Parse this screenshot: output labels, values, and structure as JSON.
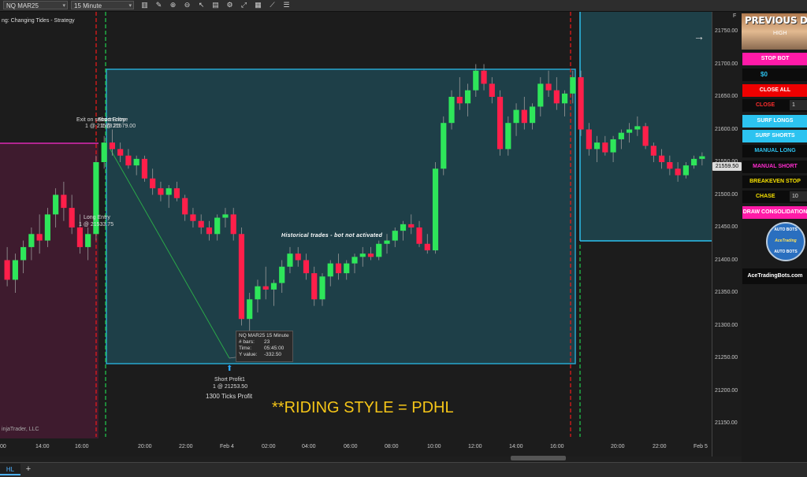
{
  "toolbar": {
    "instrument": "NQ MAR25",
    "interval": "15 Minute"
  },
  "chart": {
    "strategy_label": "ng: Changing Tides - Strategy",
    "copyright": "injaTrader, LLC",
    "annotation_main": "**RIDING STYLE = PDHL",
    "historical_note": "Historical trades - bot not activated",
    "exit_label_1": "Exit on session close",
    "exit_label_2": "Short Entry",
    "exit_label_1b": "1 @ 21573.25",
    "exit_label_2b": "1 @ 21579.00",
    "long_entry_label": "Long Entry",
    "long_entry_price": "1 @ 21533.75",
    "short_profit_label": "Short Profit1",
    "short_profit_price": "1 @ 21253.50",
    "ticks_profit": "1300 Ticks Profit",
    "current_price": "21559.50",
    "panel_letter": "F"
  },
  "tooltip": {
    "title": "NQ MAR25 15 Minute",
    "bars_label": "# bars:",
    "bars_value": "23",
    "time_label": "Time:",
    "time_value": "05:45:00",
    "yvalue_label": "Y value:",
    "yvalue_value": "-332.50"
  },
  "y_ticks": [
    "21750.00",
    "21700.00",
    "21650.00",
    "21600.00",
    "21550.00",
    "21500.00",
    "21450.00",
    "21400.00",
    "21350.00",
    "21300.00",
    "21250.00",
    "21200.00",
    "21150.00"
  ],
  "x_ticks": [
    "00",
    "14:00",
    "16:00",
    "20:00",
    "22:00",
    "Feb 4",
    "02:00",
    "04:00",
    "06:00",
    "08:00",
    "10:00",
    "12:00",
    "14:00",
    "16:00",
    "20:00",
    "22:00",
    "Feb 5"
  ],
  "candles": [
    {
      "o": 21400,
      "h": 21420,
      "l": 21360,
      "c": 21370
    },
    {
      "o": 21370,
      "h": 21410,
      "l": 21350,
      "c": 21400
    },
    {
      "o": 21400,
      "h": 21430,
      "l": 21380,
      "c": 21420
    },
    {
      "o": 21420,
      "h": 21450,
      "l": 21400,
      "c": 21440
    },
    {
      "o": 21440,
      "h": 21470,
      "l": 21410,
      "c": 21430
    },
    {
      "o": 21430,
      "h": 21480,
      "l": 21420,
      "c": 21470
    },
    {
      "o": 21470,
      "h": 21510,
      "l": 21450,
      "c": 21500
    },
    {
      "o": 21500,
      "h": 21520,
      "l": 21460,
      "c": 21480
    },
    {
      "o": 21480,
      "h": 21500,
      "l": 21440,
      "c": 21450
    },
    {
      "o": 21450,
      "h": 21470,
      "l": 21410,
      "c": 21420
    },
    {
      "o": 21420,
      "h": 21450,
      "l": 21400,
      "c": 21440
    },
    {
      "o": 21440,
      "h": 21560,
      "l": 21430,
      "c": 21550
    },
    {
      "o": 21550,
      "h": 21590,
      "l": 21540,
      "c": 21580
    },
    {
      "o": 21580,
      "h": 21600,
      "l": 21560,
      "c": 21570
    },
    {
      "o": 21570,
      "h": 21580,
      "l": 21550,
      "c": 21560
    },
    {
      "o": 21560,
      "h": 21570,
      "l": 21540,
      "c": 21545
    },
    {
      "o": 21545,
      "h": 21560,
      "l": 21530,
      "c": 21555
    },
    {
      "o": 21555,
      "h": 21560,
      "l": 21520,
      "c": 21525
    },
    {
      "o": 21525,
      "h": 21540,
      "l": 21500,
      "c": 21510
    },
    {
      "o": 21510,
      "h": 21520,
      "l": 21490,
      "c": 21500
    },
    {
      "o": 21500,
      "h": 21515,
      "l": 21480,
      "c": 21510
    },
    {
      "o": 21510,
      "h": 21520,
      "l": 21490,
      "c": 21495
    },
    {
      "o": 21495,
      "h": 21500,
      "l": 21460,
      "c": 21470
    },
    {
      "o": 21470,
      "h": 21480,
      "l": 21450,
      "c": 21460
    },
    {
      "o": 21460,
      "h": 21470,
      "l": 21440,
      "c": 21450
    },
    {
      "o": 21450,
      "h": 21460,
      "l": 21430,
      "c": 21440
    },
    {
      "o": 21440,
      "h": 21470,
      "l": 21430,
      "c": 21465
    },
    {
      "o": 21465,
      "h": 21480,
      "l": 21450,
      "c": 21470
    },
    {
      "o": 21470,
      "h": 21480,
      "l": 21430,
      "c": 21440
    },
    {
      "o": 21440,
      "h": 21450,
      "l": 21300,
      "c": 21310
    },
    {
      "o": 21310,
      "h": 21350,
      "l": 21260,
      "c": 21340
    },
    {
      "o": 21340,
      "h": 21370,
      "l": 21320,
      "c": 21360
    },
    {
      "o": 21360,
      "h": 21390,
      "l": 21340,
      "c": 21355
    },
    {
      "o": 21355,
      "h": 21370,
      "l": 21330,
      "c": 21365
    },
    {
      "o": 21365,
      "h": 21400,
      "l": 21350,
      "c": 21390
    },
    {
      "o": 21390,
      "h": 21420,
      "l": 21380,
      "c": 21410
    },
    {
      "o": 21410,
      "h": 21420,
      "l": 21390,
      "c": 21400
    },
    {
      "o": 21400,
      "h": 21410,
      "l": 21370,
      "c": 21380
    },
    {
      "o": 21380,
      "h": 21390,
      "l": 21330,
      "c": 21340
    },
    {
      "o": 21340,
      "h": 21380,
      "l": 21330,
      "c": 21375
    },
    {
      "o": 21375,
      "h": 21400,
      "l": 21360,
      "c": 21395
    },
    {
      "o": 21395,
      "h": 21410,
      "l": 21370,
      "c": 21380
    },
    {
      "o": 21380,
      "h": 21400,
      "l": 21370,
      "c": 21395
    },
    {
      "o": 21395,
      "h": 21410,
      "l": 21380,
      "c": 21405
    },
    {
      "o": 21405,
      "h": 21420,
      "l": 21390,
      "c": 21410
    },
    {
      "o": 21410,
      "h": 21420,
      "l": 21400,
      "c": 21405
    },
    {
      "o": 21405,
      "h": 21430,
      "l": 21400,
      "c": 21425
    },
    {
      "o": 21425,
      "h": 21440,
      "l": 21410,
      "c": 21430
    },
    {
      "o": 21430,
      "h": 21450,
      "l": 21420,
      "c": 21445
    },
    {
      "o": 21445,
      "h": 21460,
      "l": 21430,
      "c": 21455
    },
    {
      "o": 21455,
      "h": 21470,
      "l": 21440,
      "c": 21450
    },
    {
      "o": 21450,
      "h": 21460,
      "l": 21420,
      "c": 21425
    },
    {
      "o": 21425,
      "h": 21440,
      "l": 21410,
      "c": 21415
    },
    {
      "o": 21415,
      "h": 21550,
      "l": 21410,
      "c": 21540
    },
    {
      "o": 21540,
      "h": 21620,
      "l": 21530,
      "c": 21610
    },
    {
      "o": 21610,
      "h": 21660,
      "l": 21600,
      "c": 21650
    },
    {
      "o": 21650,
      "h": 21680,
      "l": 21630,
      "c": 21640
    },
    {
      "o": 21640,
      "h": 21670,
      "l": 21620,
      "c": 21660
    },
    {
      "o": 21660,
      "h": 21700,
      "l": 21650,
      "c": 21690
    },
    {
      "o": 21690,
      "h": 21700,
      "l": 21660,
      "c": 21670
    },
    {
      "o": 21670,
      "h": 21680,
      "l": 21640,
      "c": 21650
    },
    {
      "o": 21650,
      "h": 21660,
      "l": 21560,
      "c": 21570
    },
    {
      "o": 21570,
      "h": 21620,
      "l": 21560,
      "c": 21610
    },
    {
      "o": 21610,
      "h": 21640,
      "l": 21590,
      "c": 21630
    },
    {
      "o": 21630,
      "h": 21650,
      "l": 21600,
      "c": 21610
    },
    {
      "o": 21610,
      "h": 21640,
      "l": 21600,
      "c": 21635
    },
    {
      "o": 21635,
      "h": 21680,
      "l": 21620,
      "c": 21670
    },
    {
      "o": 21670,
      "h": 21690,
      "l": 21650,
      "c": 21660
    },
    {
      "o": 21660,
      "h": 21680,
      "l": 21630,
      "c": 21640
    },
    {
      "o": 21640,
      "h": 21660,
      "l": 21620,
      "c": 21655
    },
    {
      "o": 21655,
      "h": 21690,
      "l": 21640,
      "c": 21680
    },
    {
      "o": 21680,
      "h": 21690,
      "l": 21590,
      "c": 21600
    },
    {
      "o": 21600,
      "h": 21610,
      "l": 21560,
      "c": 21570
    },
    {
      "o": 21570,
      "h": 21590,
      "l": 21550,
      "c": 21580
    },
    {
      "o": 21580,
      "h": 21590,
      "l": 21560,
      "c": 21565
    },
    {
      "o": 21565,
      "h": 21590,
      "l": 21550,
      "c": 21585
    },
    {
      "o": 21585,
      "h": 21600,
      "l": 21570,
      "c": 21595
    },
    {
      "o": 21595,
      "h": 21610,
      "l": 21580,
      "c": 21600
    },
    {
      "o": 21600,
      "h": 21620,
      "l": 21590,
      "c": 21605
    },
    {
      "o": 21605,
      "h": 21610,
      "l": 21570,
      "c": 21575
    },
    {
      "o": 21575,
      "h": 21580,
      "l": 21550,
      "c": 21560
    },
    {
      "o": 21560,
      "h": 21570,
      "l": 21540,
      "c": 21550
    },
    {
      "o": 21550,
      "h": 21560,
      "l": 21530,
      "c": 21540
    },
    {
      "o": 21540,
      "h": 21550,
      "l": 21520,
      "c": 21530
    },
    {
      "o": 21530,
      "h": 21550,
      "l": 21525,
      "c": 21545
    },
    {
      "o": 21545,
      "h": 21560,
      "l": 21540,
      "c": 21555
    },
    {
      "o": 21555,
      "h": 21565,
      "l": 21545,
      "c": 21559
    }
  ],
  "panel": {
    "banner_title": "PREVIOUS D",
    "banner_sub": "HIGH",
    "stop_bot": "STOP BOT",
    "pnl": "$0",
    "close_all": "CLOSE ALL",
    "close_label": "CLOSE",
    "close_qty": "1",
    "surf_longs": "SURF LONGS",
    "surf_shorts": "SURF SHORTS",
    "manual_long": "MANUAL LONG",
    "manual_short": "MANUAL SHORT",
    "breakeven_stop": "BREAKEVEN STOP",
    "chase_label": "CHASE",
    "chase_qty": "10",
    "draw_consolidation": "DRAW CONSOLIDATION",
    "logo_top": "AUTO BOTS",
    "logo_mid": "AceTrading",
    "logo_bottom": "AUTO BOTS",
    "site": "AceTradingBots.com"
  },
  "bottom": {
    "tab_label": "HL",
    "add_tab": "+"
  }
}
